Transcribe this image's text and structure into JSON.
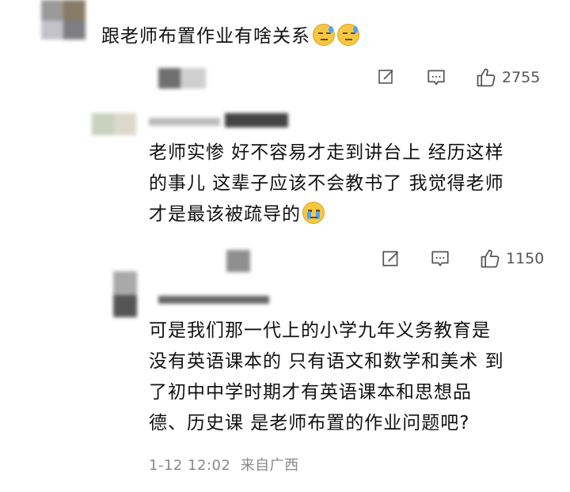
{
  "comments": [
    {
      "text": "跟老师布置作业有啥关系",
      "emojis": [
        "cold-sweat-emoji",
        "cold-sweat-emoji"
      ],
      "like_count": "2755"
    },
    {
      "lines": [
        "老师实惨 好不容易才走到讲台上 经历这样",
        "的事儿 这辈子应该不会教书了 我觉得老师",
        "才是最该被疏导的"
      ],
      "emoji": "crying-emoji",
      "like_count": "1150"
    },
    {
      "lines": [
        "可是我们那一代上的小学九年义务教育是",
        "没有英语课本的 只有语文和数学和美术 到",
        "了初中中学时期才有英语课本和思想品",
        "德、历史课 是老师布置的作业问题吧?"
      ],
      "timestamp": "1-12 12:02",
      "location": "来自广西"
    }
  ],
  "colors": {
    "text": "#111111",
    "meta": "#8a8a8a",
    "icon": "#555555",
    "emoji": "#f6c743"
  }
}
